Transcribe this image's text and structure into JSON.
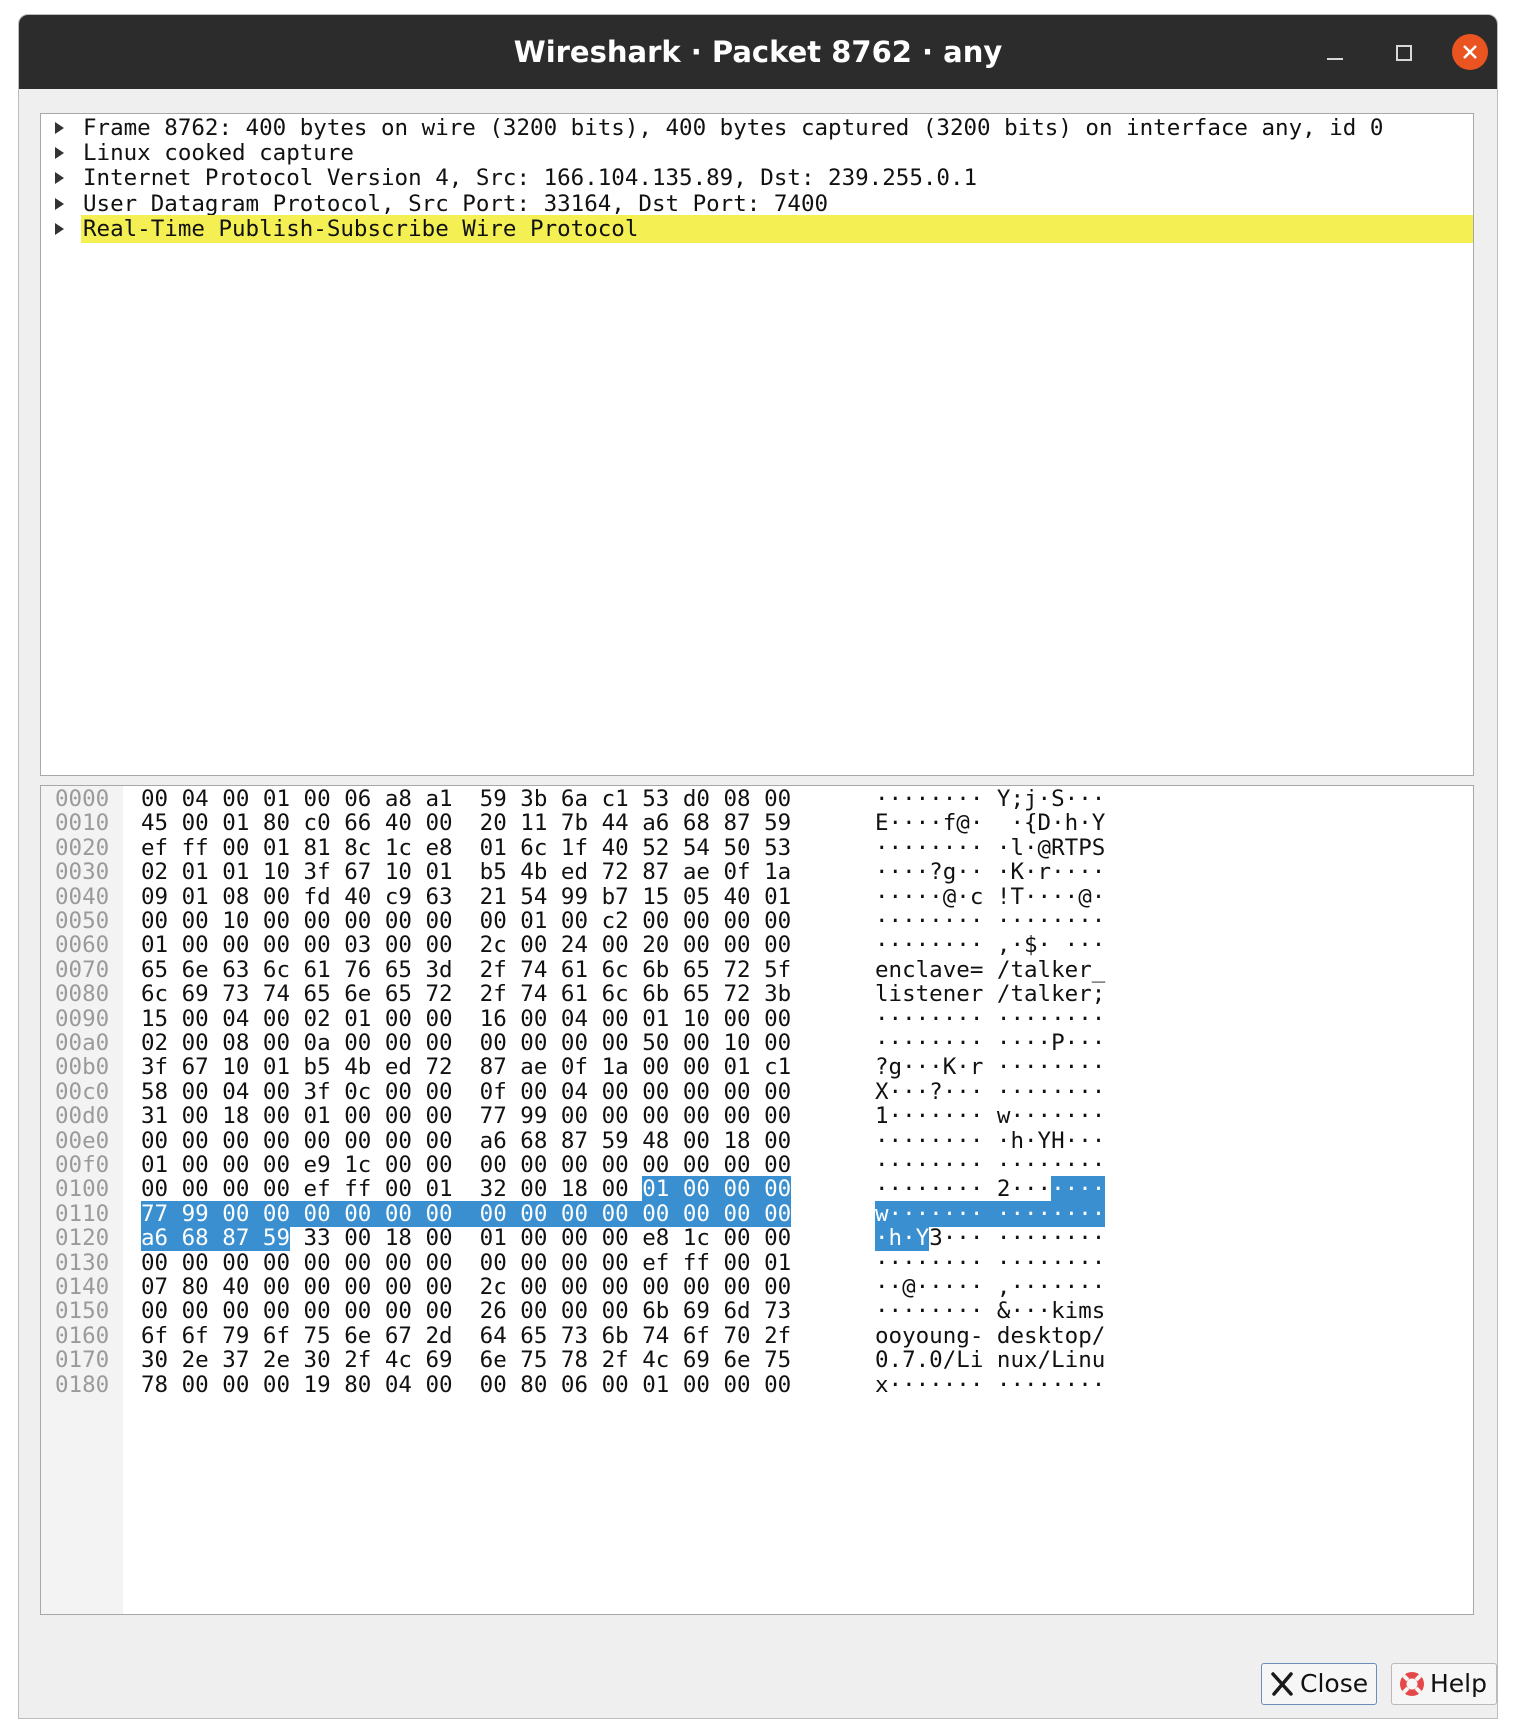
{
  "window": {
    "title": "Wireshark · Packet 8762 · any"
  },
  "tree": {
    "rows": [
      {
        "label": "Frame 8762: 400 bytes on wire (3200 bits), 400 bytes captured (3200 bits) on interface any, id 0"
      },
      {
        "label": "Linux cooked capture"
      },
      {
        "label": "Internet Protocol Version 4, Src: 166.104.135.89, Dst: 239.255.0.1"
      },
      {
        "label": "User Datagram Protocol, Src Port: 33164, Dst Port: 7400"
      },
      {
        "label": "Real-Time Publish-Subscribe Wire Protocol",
        "selected": true
      }
    ]
  },
  "hex": {
    "lines": [
      {
        "offset": "0000",
        "bytes": "00 04 00 01 00 06 a8 a1  59 3b 6a c1 53 d0 08 00",
        "ascii": "········ Y;j·S···"
      },
      {
        "offset": "0010",
        "bytes": "45 00 01 80 c0 66 40 00  20 11 7b 44 a6 68 87 59",
        "ascii": "E····f@·  ·{D·h·Y"
      },
      {
        "offset": "0020",
        "bytes": "ef ff 00 01 81 8c 1c e8  01 6c 1f 40 52 54 50 53",
        "ascii": "········ ·l·@RTPS"
      },
      {
        "offset": "0030",
        "bytes": "02 01 01 10 3f 67 10 01  b5 4b ed 72 87 ae 0f 1a",
        "ascii": "····?g·· ·K·r····"
      },
      {
        "offset": "0040",
        "bytes": "09 01 08 00 fd 40 c9 63  21 54 99 b7 15 05 40 01",
        "ascii": "·····@·c !T····@·"
      },
      {
        "offset": "0050",
        "bytes": "00 00 10 00 00 00 00 00  00 01 00 c2 00 00 00 00",
        "ascii": "········ ········"
      },
      {
        "offset": "0060",
        "bytes": "01 00 00 00 00 03 00 00  2c 00 24 00 20 00 00 00",
        "ascii": "········ ,·$· ···"
      },
      {
        "offset": "0070",
        "bytes": "65 6e 63 6c 61 76 65 3d  2f 74 61 6c 6b 65 72 5f",
        "ascii": "enclave= /talker_"
      },
      {
        "offset": "0080",
        "bytes": "6c 69 73 74 65 6e 65 72  2f 74 61 6c 6b 65 72 3b",
        "ascii": "listener /talker;"
      },
      {
        "offset": "0090",
        "bytes": "15 00 04 00 02 01 00 00  16 00 04 00 01 10 00 00",
        "ascii": "········ ········"
      },
      {
        "offset": "00a0",
        "bytes": "02 00 08 00 0a 00 00 00  00 00 00 00 50 00 10 00",
        "ascii": "········ ····P···"
      },
      {
        "offset": "00b0",
        "bytes": "3f 67 10 01 b5 4b ed 72  87 ae 0f 1a 00 00 01 c1",
        "ascii": "?g···K·r ········"
      },
      {
        "offset": "00c0",
        "bytes": "58 00 04 00 3f 0c 00 00  0f 00 04 00 00 00 00 00",
        "ascii": "X···?··· ········"
      },
      {
        "offset": "00d0",
        "bytes": "31 00 18 00 01 00 00 00  77 99 00 00 00 00 00 00",
        "ascii": "1······· w·······"
      },
      {
        "offset": "00e0",
        "bytes": "00 00 00 00 00 00 00 00  a6 68 87 59 48 00 18 00",
        "ascii": "········ ·h·YH···"
      },
      {
        "offset": "00f0",
        "bytes": "01 00 00 00 e9 1c 00 00  00 00 00 00 00 00 00 00",
        "ascii": "········ ········"
      },
      {
        "offset": "0100",
        "bytes": "00 00 00 00 ef ff 00 01  32 00 18 00 01 00 00 00",
        "ascii": "········ 2·······",
        "hl": [
          12,
          16
        ]
      },
      {
        "offset": "0110",
        "bytes": "77 99 00 00 00 00 00 00  00 00 00 00 00 00 00 00",
        "ascii": "w······· ········",
        "hl": [
          0,
          16
        ]
      },
      {
        "offset": "0120",
        "bytes": "a6 68 87 59 33 00 18 00  01 00 00 00 e8 1c 00 00",
        "ascii": "·h·Y3··· ········",
        "hl": [
          0,
          4
        ]
      },
      {
        "offset": "0130",
        "bytes": "00 00 00 00 00 00 00 00  00 00 00 00 ef ff 00 01",
        "ascii": "········ ········"
      },
      {
        "offset": "0140",
        "bytes": "07 80 40 00 00 00 00 00  2c 00 00 00 00 00 00 00",
        "ascii": "··@····· ,·······"
      },
      {
        "offset": "0150",
        "bytes": "00 00 00 00 00 00 00 00  26 00 00 00 6b 69 6d 73",
        "ascii": "········ &···kims"
      },
      {
        "offset": "0160",
        "bytes": "6f 6f 79 6f 75 6e 67 2d  64 65 73 6b 74 6f 70 2f",
        "ascii": "ooyoung- desktop/"
      },
      {
        "offset": "0170",
        "bytes": "30 2e 37 2e 30 2f 4c 69  6e 75 78 2f 4c 69 6e 75",
        "ascii": "0.7.0/Li nux/Linu"
      },
      {
        "offset": "0180",
        "bytes": "78 00 00 00 19 80 04 00  00 80 06 00 01 00 00 00",
        "ascii": "x······· ········"
      }
    ]
  },
  "buttons": {
    "close_label": "Close",
    "help_label": "Help"
  },
  "colors": {
    "selection_highlight": "#f4f054",
    "byte_highlight": "#3a8fd0",
    "titlebar": "#2c2c2c",
    "close_button": "#e95420"
  },
  "icons": {
    "close_button_icon": "close-x-icon",
    "help_button_icon": "help-lifebuoy-icon"
  }
}
